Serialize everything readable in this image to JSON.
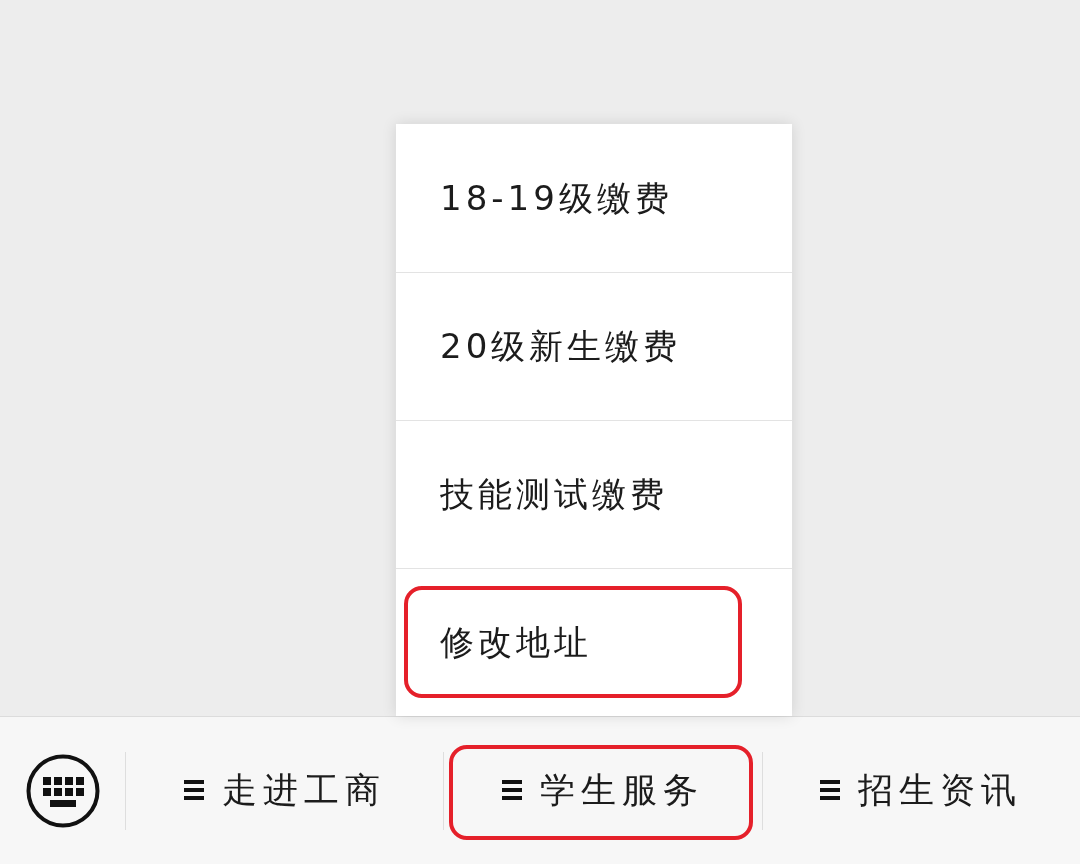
{
  "popup_menu": {
    "items": [
      {
        "label": "18-19级缴费",
        "highlighted": false
      },
      {
        "label": "20级新生缴费",
        "highlighted": false
      },
      {
        "label": "技能测试缴费",
        "highlighted": false
      },
      {
        "label": "修改地址",
        "highlighted": true
      }
    ]
  },
  "menu_bar": {
    "items": [
      {
        "label": "走进工商",
        "highlighted": false
      },
      {
        "label": "学生服务",
        "highlighted": true
      },
      {
        "label": "招生资讯",
        "highlighted": false
      }
    ]
  }
}
